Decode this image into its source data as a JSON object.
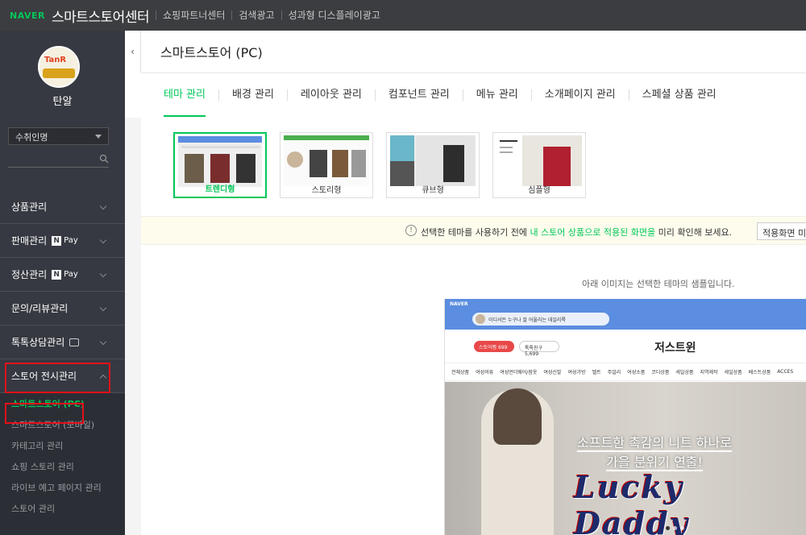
{
  "topbar": {
    "logo": "NAVER",
    "title": "스마트스토어센터",
    "nav": [
      "쇼핑파트너센터",
      "검색광고",
      "성과형 디스플레이광고"
    ]
  },
  "sidebar": {
    "profile_name": "탄알",
    "avatar_text": "TanR",
    "store_select": "수취인명",
    "menu": [
      {
        "label": "상품관리"
      },
      {
        "label": "판매관리",
        "badge": "Pay"
      },
      {
        "label": "정산관리",
        "badge": "Pay"
      },
      {
        "label": "문의/리뷰관리"
      },
      {
        "label": "톡톡상담관리"
      },
      {
        "label": "스토어 전시관리"
      }
    ],
    "submenu": [
      "스마트스토어 (PC)",
      "스마트스토어 (모바일)",
      "카테고리 관리",
      "쇼핑 스토리 관리",
      "라이브 예고 페이지 관리",
      "스토어 관리"
    ]
  },
  "main": {
    "page_title": "스마트스토어 (PC)",
    "tabs": [
      "테마 관리",
      "배경 관리",
      "레이아웃 관리",
      "컴포넌트 관리",
      "메뉴 관리",
      "소개페이지 관리",
      "스페셜 상품 관리"
    ],
    "themes": [
      "트렌디형",
      "스토리형",
      "큐브형",
      "심플형"
    ],
    "notice": {
      "prefix": "선택한 테마를 사용하기 전에 ",
      "highlight": "내 스토어 상품으로 적용된 화면을",
      "suffix": " 미리 확인해 보세요.",
      "button": "적용화면 미리보기"
    },
    "sample_caption": "아래 이미지는 선택한 테마의 샘플입니다."
  },
  "sample": {
    "logo": "NAVER",
    "banner_text": "이디서든 누구나 잘 어울리는 데일리룩",
    "store_name": "저스트윈",
    "red_pill": "스토어찜 699",
    "green_pill": "톡톡친구 5,699",
    "categories": [
      "전체상품",
      "여성의류",
      "여성언더웨어/잠옷",
      "여성신발",
      "여성가방",
      "벨트",
      "주얼리",
      "여성소품",
      "코디상품",
      "세일상품",
      "지역제작",
      "세일상품",
      "베스트상품",
      "ACCES"
    ],
    "hero_line1": "소프트한 촉감의 니트 하나로",
    "hero_line2": "가을 분위기 연출!",
    "watermark": "Lucky Daddy"
  }
}
